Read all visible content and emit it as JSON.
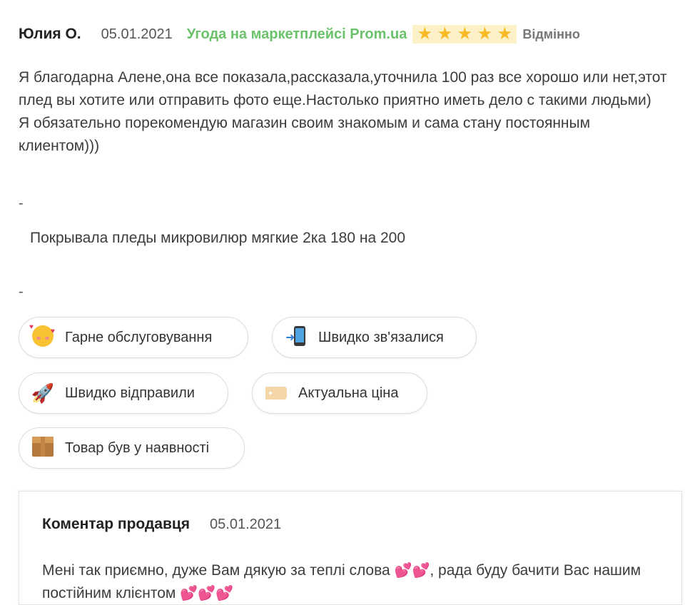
{
  "review": {
    "author": "Юлия О.",
    "date": "05.01.2021",
    "marketplace": "Угода на маркетплейсі Prom.ua",
    "rating": {
      "stars": 5,
      "max": 5,
      "label": "Відмінно",
      "star_color": "#f7b924"
    },
    "text": {
      "line1": "Я благодарна Алене,она все показала,рассказала,уточнила 100 раз все хорошо или нет,этот плед вы хотите или отправить фото еще.Настолько приятно иметь дело с такими людьми)",
      "line2": "Я обязательно порекомендую магазин своим знакомым и сама стану постоянным клиентом)))"
    },
    "separator1": "-",
    "product": "Покрывала пледы микровилюр мягкие 2ка 180 на 200",
    "separator2": "-"
  },
  "tags": [
    {
      "label": "Гарне обслуговування",
      "icon": "smiling-face-with-hearts-icon"
    },
    {
      "label": "Швидко зв'язалися",
      "icon": "mobile-phone-arrow-icon"
    },
    {
      "label": "Швидко відправили",
      "icon": "rocket-icon"
    },
    {
      "label": "Актуальна ціна",
      "icon": "price-tag-icon"
    },
    {
      "label": "Товар був у наявності",
      "icon": "package-box-icon"
    }
  ],
  "seller_comment": {
    "title": "Коментар продавця",
    "date": "05.01.2021",
    "text_part1": "Мені так приємно, дуже Вам дякую за теплі слова ",
    "hearts1": "💕💕",
    "text_part2": ", рада буду бачити Вас нашим постійним клієнтом ",
    "hearts2": "💕💕💕"
  },
  "colors": {
    "marketplace_green": "#6bc26a",
    "accent_star": "#f7b924"
  }
}
